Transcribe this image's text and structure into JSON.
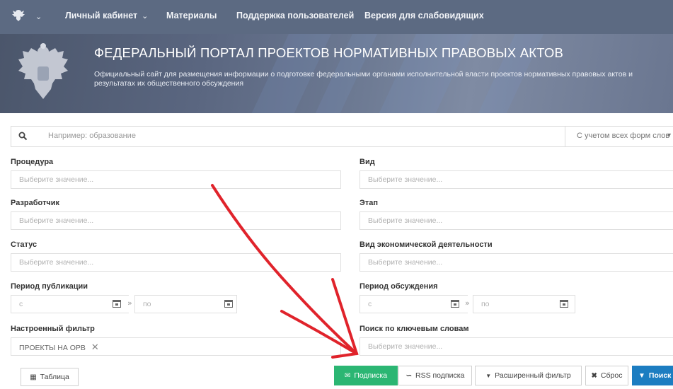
{
  "nav": {
    "items": [
      {
        "label": "Личный кабинет",
        "dropdown": true
      },
      {
        "label": "Материалы"
      },
      {
        "label": "Поддержка пользователей"
      },
      {
        "label": "Версия для слабовидящих"
      }
    ]
  },
  "banner": {
    "title": "ФЕДЕРАЛЬНЫЙ ПОРТАЛ ПРОЕКТОВ НОРМАТИВНЫХ ПРАВОВЫХ АКТОВ",
    "subtitle": "Официальный сайт для размещения информации о подготовке федеральными органами исполнительной власти проектов нормативных правовых актов и результатах их общественного обсуждения"
  },
  "search": {
    "placeholder": "Например: образование",
    "mode": "С учетом всех форм слов"
  },
  "filters": {
    "procedure": {
      "label": "Процедура",
      "placeholder": "Выберите значение..."
    },
    "kind": {
      "label": "Вид",
      "placeholder": "Выберите значение..."
    },
    "developer": {
      "label": "Разработчик",
      "placeholder": "Выберите значение..."
    },
    "stage": {
      "label": "Этап",
      "placeholder": "Выберите значение..."
    },
    "status": {
      "label": "Статус",
      "placeholder": "Выберите значение..."
    },
    "economic_activity": {
      "label": "Вид экономической деятельности",
      "placeholder": "Выберите значение..."
    },
    "publication_period": {
      "label": "Период публикации",
      "from": "с",
      "to": "по"
    },
    "discussion_period": {
      "label": "Период обсуждения",
      "from": "с",
      "to": "по"
    },
    "saved_filter": {
      "label": "Настроенный фильтр",
      "chip": "ПРОЕКТЫ НА ОРВ"
    },
    "keywords": {
      "label": "Поиск по ключевым словам",
      "placeholder": "Выберите значение..."
    }
  },
  "buttons": {
    "table": "Таблица",
    "subscribe": "Подписка",
    "rss": "RSS подписка",
    "advanced": "Расширенный фильтр",
    "reset": "Сброс",
    "search": "Поиск"
  },
  "colors": {
    "nav_bg": "#5c6a82",
    "subscribe_green": "#2bb673",
    "search_blue": "#1c7dc1",
    "annotation_red": "#e0232b"
  }
}
